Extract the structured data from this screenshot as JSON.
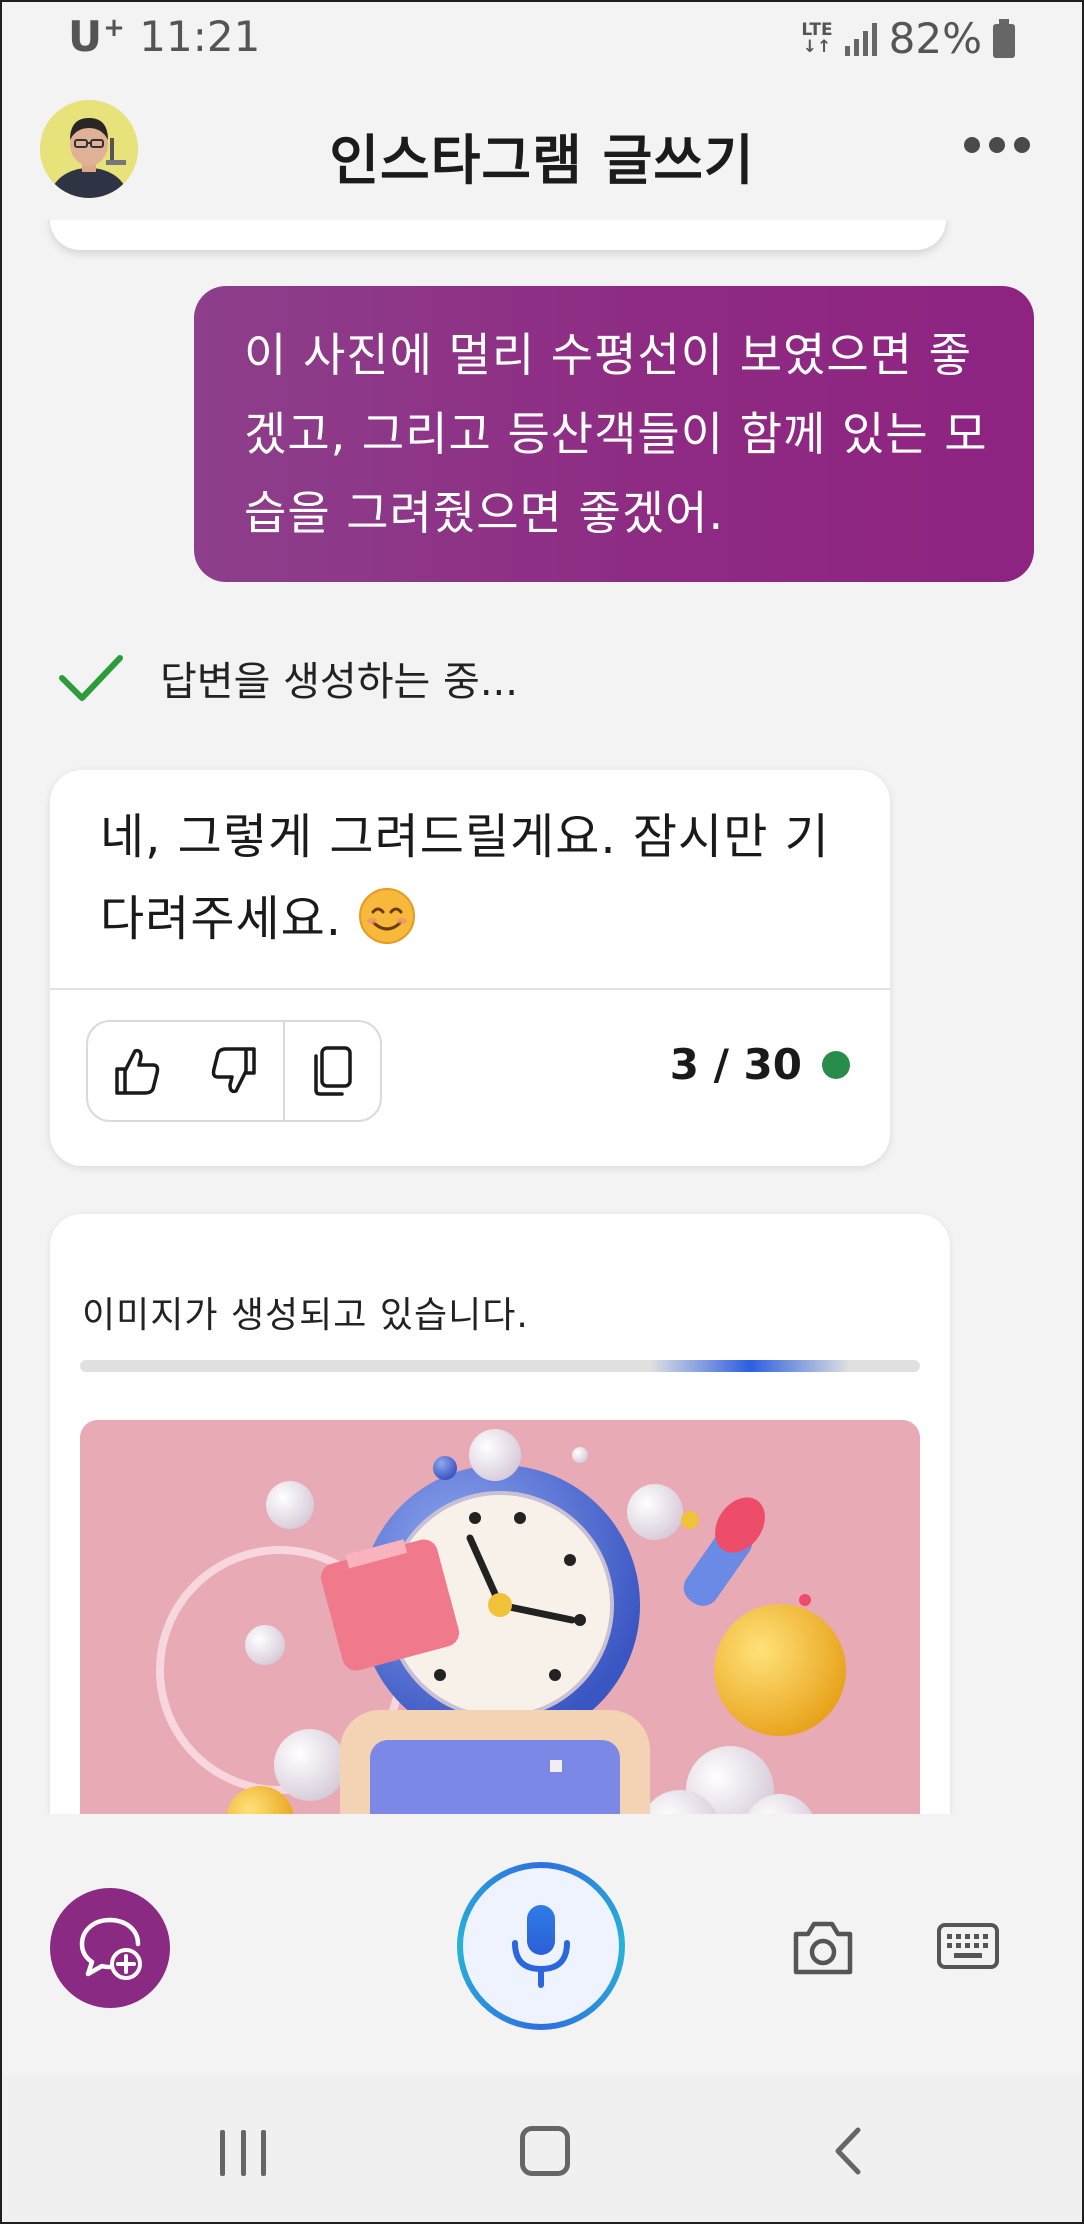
{
  "status_bar": {
    "carrier": "U",
    "carrier_plus": "+",
    "time": "11:21",
    "network_top": "LTE",
    "network_bottom": "↓↑",
    "battery": "82%"
  },
  "header": {
    "title": "인스타그램 글쓰기"
  },
  "conversation": {
    "user_message": "이 사진에 멀리 수평선이 보였으면 좋겠고, 그리고 등산객들이 함께 있는 모습을 그려줬으면 좋겠어.",
    "progress_status": "답변을 생성하는 중...",
    "assistant_message": "네, 그렇게 그려드릴게요. 잠시만 기다려주세요.",
    "turn_counter": "3 / 30",
    "image_status": "이미지가 생성되고 있습니다."
  },
  "icons": {
    "like": "thumbs-up-icon",
    "dislike": "thumbs-down-icon",
    "copy": "copy-icon",
    "new_topic": "new-chat-icon",
    "mic": "microphone-icon",
    "camera": "camera-icon",
    "keyboard": "keyboard-icon"
  },
  "colors": {
    "user_bubble": "#8e2b83",
    "check": "#2a9c3a",
    "counter_dot": "#2a8c4a",
    "mic_ring": "#2f6fe0"
  }
}
